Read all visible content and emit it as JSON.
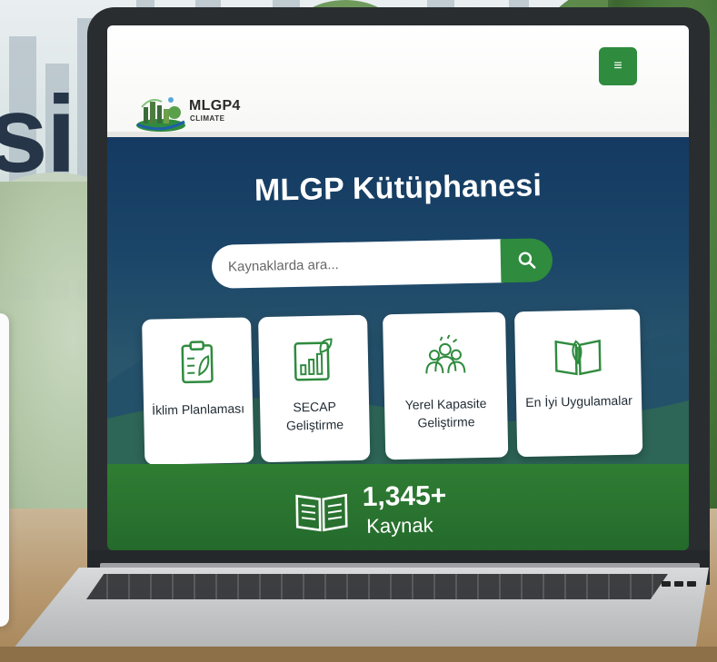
{
  "background": {
    "partial_heading": "si"
  },
  "header": {
    "logo_title": "MLGP4",
    "logo_subtitle": "CLIMATE",
    "menu_icon": "hamburger-icon"
  },
  "hero": {
    "title": "MLGP Kütüphanesi"
  },
  "search": {
    "placeholder": "Kaynaklarda ara...",
    "button_icon": "search-icon"
  },
  "categories": [
    {
      "label": "İklim Planlaması",
      "icon": "clipboard-leaf-icon"
    },
    {
      "label": "SECAP Geliştirme",
      "icon": "chart-growth-icon"
    },
    {
      "label": "Yerel Kapasite Geliştirme",
      "icon": "people-group-icon"
    },
    {
      "label": "En İyi Uygulamalar",
      "icon": "book-leaf-icon"
    }
  ],
  "stats": {
    "count": "1,345+",
    "label": "Kaynak",
    "icon": "open-book-icon"
  },
  "colors": {
    "brand_green": "#2f8b3e",
    "hero_navy": "#143a62",
    "band_green": "#2a7430",
    "text_dark": "#1f2a33"
  }
}
